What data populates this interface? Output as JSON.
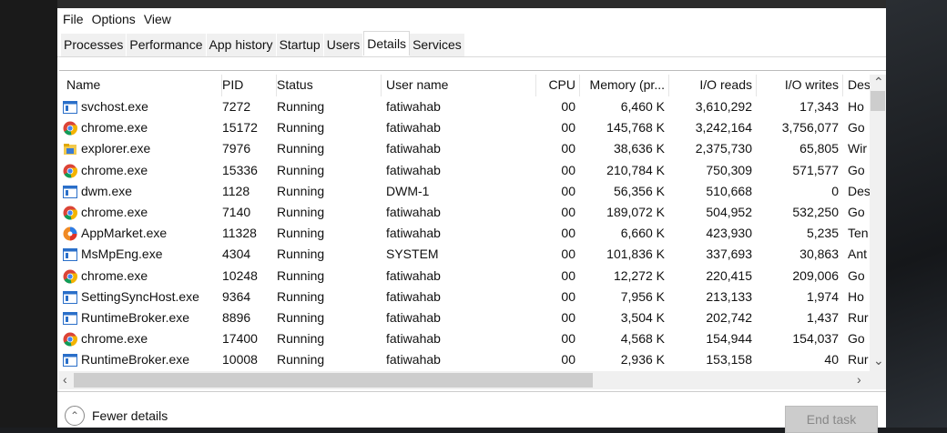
{
  "menu": [
    "File",
    "Options",
    "View"
  ],
  "tabs": [
    "Processes",
    "Performance",
    "App history",
    "Startup",
    "Users",
    "Details",
    "Services"
  ],
  "active_tab": "Details",
  "columns": [
    "Name",
    "PID",
    "Status",
    "User name",
    "CPU",
    "Memory (pr...",
    "I/O reads",
    "I/O writes",
    "Des"
  ],
  "rows": [
    {
      "name": "svchost.exe",
      "icon": "app-window-icon",
      "pid": "7272",
      "status": "Running",
      "user": "fatiwahab",
      "cpu": "00",
      "mem": "6,460 K",
      "ior": "3,610,292",
      "iow": "17,343",
      "desc": "Ho"
    },
    {
      "name": "chrome.exe",
      "icon": "chrome-icon",
      "pid": "15172",
      "status": "Running",
      "user": "fatiwahab",
      "cpu": "00",
      "mem": "145,768 K",
      "ior": "3,242,164",
      "iow": "3,756,077",
      "desc": "Go"
    },
    {
      "name": "explorer.exe",
      "icon": "folder-icon",
      "pid": "7976",
      "status": "Running",
      "user": "fatiwahab",
      "cpu": "00",
      "mem": "38,636 K",
      "ior": "2,375,730",
      "iow": "65,805",
      "desc": "Wir"
    },
    {
      "name": "chrome.exe",
      "icon": "chrome-icon",
      "pid": "15336",
      "status": "Running",
      "user": "fatiwahab",
      "cpu": "00",
      "mem": "210,784 K",
      "ior": "750,309",
      "iow": "571,577",
      "desc": "Go"
    },
    {
      "name": "dwm.exe",
      "icon": "app-window-icon",
      "pid": "1128",
      "status": "Running",
      "user": "DWM-1",
      "cpu": "00",
      "mem": "56,356 K",
      "ior": "510,668",
      "iow": "0",
      "desc": "Des"
    },
    {
      "name": "chrome.exe",
      "icon": "chrome-icon",
      "pid": "7140",
      "status": "Running",
      "user": "fatiwahab",
      "cpu": "00",
      "mem": "189,072 K",
      "ior": "504,952",
      "iow": "532,250",
      "desc": "Go"
    },
    {
      "name": "AppMarket.exe",
      "icon": "appmarket-icon",
      "pid": "11328",
      "status": "Running",
      "user": "fatiwahab",
      "cpu": "00",
      "mem": "6,660 K",
      "ior": "423,930",
      "iow": "5,235",
      "desc": "Ten"
    },
    {
      "name": "MsMpEng.exe",
      "icon": "app-window-icon",
      "pid": "4304",
      "status": "Running",
      "user": "SYSTEM",
      "cpu": "00",
      "mem": "101,836 K",
      "ior": "337,693",
      "iow": "30,863",
      "desc": "Ant"
    },
    {
      "name": "chrome.exe",
      "icon": "chrome-icon",
      "pid": "10248",
      "status": "Running",
      "user": "fatiwahab",
      "cpu": "00",
      "mem": "12,272 K",
      "ior": "220,415",
      "iow": "209,006",
      "desc": "Go"
    },
    {
      "name": "SettingSyncHost.exe",
      "icon": "app-window-icon",
      "pid": "9364",
      "status": "Running",
      "user": "fatiwahab",
      "cpu": "00",
      "mem": "7,956 K",
      "ior": "213,133",
      "iow": "1,974",
      "desc": "Ho"
    },
    {
      "name": "RuntimeBroker.exe",
      "icon": "app-window-icon",
      "pid": "8896",
      "status": "Running",
      "user": "fatiwahab",
      "cpu": "00",
      "mem": "3,504 K",
      "ior": "202,742",
      "iow": "1,437",
      "desc": "Rur"
    },
    {
      "name": "chrome.exe",
      "icon": "chrome-icon",
      "pid": "17400",
      "status": "Running",
      "user": "fatiwahab",
      "cpu": "00",
      "mem": "4,568 K",
      "ior": "154,944",
      "iow": "154,037",
      "desc": "Go"
    },
    {
      "name": "RuntimeBroker.exe",
      "icon": "app-window-icon",
      "pid": "10008",
      "status": "Running",
      "user": "fatiwahab",
      "cpu": "00",
      "mem": "2,936 K",
      "ior": "153,158",
      "iow": "40",
      "desc": "Rur"
    }
  ],
  "footer": {
    "fewer_details": "Fewer details",
    "end_task": "End task"
  }
}
